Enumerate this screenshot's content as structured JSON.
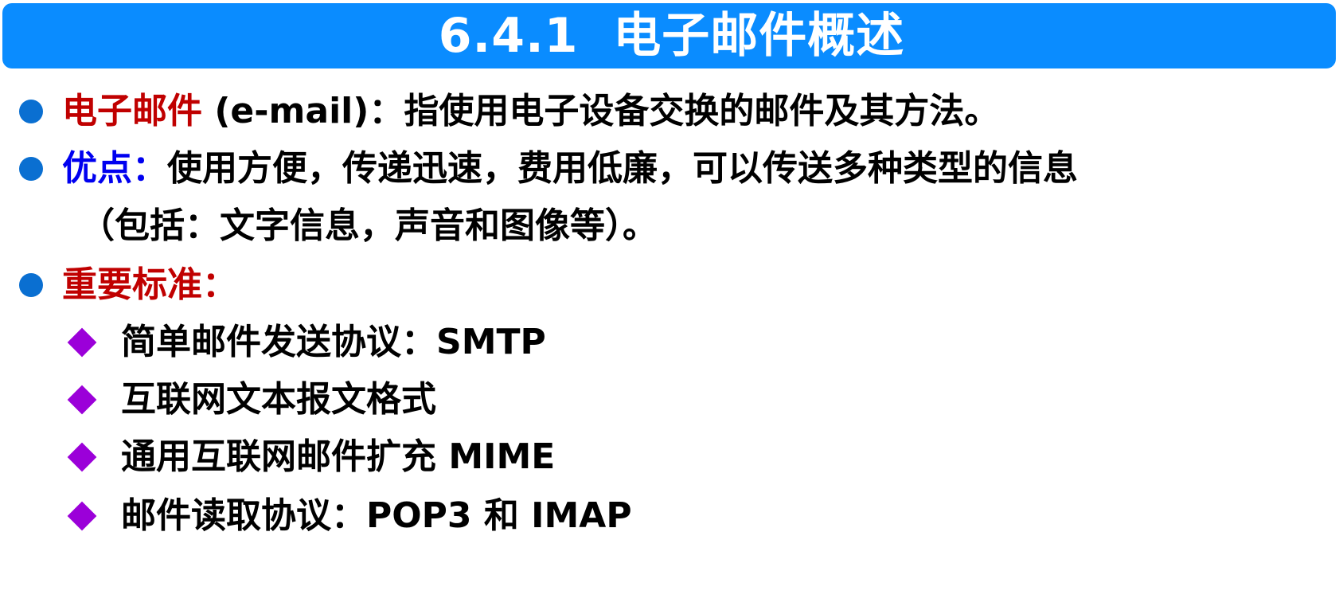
{
  "title": "6.4.1  电子邮件概述",
  "bullets": [
    {
      "label": "电子邮件",
      "label_color": "#c00000",
      "text": " (e-mail)：指使用电子设备交换的邮件及其方法。"
    },
    {
      "label": "优点：",
      "label_color": "#0000f0",
      "text": "使用方便，传递迅速，费用低廉，可以传送多种类型的信息",
      "continuation": "（包括：文字信息，声音和图像等）。"
    },
    {
      "label": "重要标准：",
      "label_color": "#c00000",
      "items": [
        "简单邮件发送协议：SMTP",
        "互联网文本报文格式",
        "通用互联网邮件扩充 MIME",
        "邮件读取协议：POP3 和 IMAP"
      ]
    }
  ],
  "colors": {
    "title_bar": "#0a8cff",
    "bullet_dot": "#0a6fd1",
    "sub_bullet": "#9b00d9"
  },
  "icons": {
    "bullet": "circle-bullet-icon",
    "sub_bullet": "diamond-bullet-icon"
  }
}
